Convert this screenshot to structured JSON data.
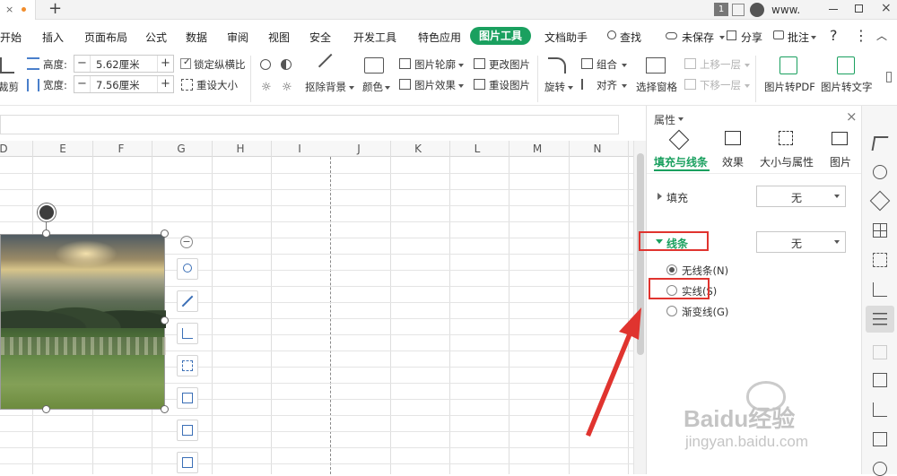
{
  "titlebar": {
    "tab_dot_color": "#f18d2c",
    "new_tab_symbol": "+",
    "page_badge": "1",
    "user_name": "www."
  },
  "menu": {
    "items": [
      "开始",
      "插入",
      "页面布局",
      "公式",
      "数据",
      "审阅",
      "视图",
      "安全",
      "开发工具",
      "特色应用",
      "图片工具",
      "文档助手"
    ],
    "active_tab": "图片工具",
    "active_color": "#1aa05f",
    "search_label": "查找",
    "unsaved_label": "未保存",
    "share_label": "分享",
    "comment_label": "批注",
    "help_symbol": "?"
  },
  "ribbon": {
    "crop_label": "裁剪",
    "height_label": "高度:",
    "height_value": "5.62厘米",
    "width_label": "宽度:",
    "width_value": "7.56厘米",
    "lock_ratio_label": "锁定纵横比",
    "lock_ratio_checked": true,
    "reset_size_label": "重设大小",
    "remove_bg_label": "抠除背景",
    "color_label": "颜色",
    "outline_label": "图片轮廓",
    "effects_label": "图片效果",
    "change_pic_label": "更改图片",
    "reset_pic_label": "重设图片",
    "rotate_label": "旋转",
    "group_label": "组合",
    "align_label": "对齐",
    "selection_pane_label": "选择窗格",
    "bring_forward_label": "上移一层",
    "send_backward_label": "下移一层",
    "to_pdf_label": "图片转PDF",
    "to_text_label": "图片转文字"
  },
  "sheet": {
    "columns": [
      "D",
      "E",
      "F",
      "G",
      "H",
      "I",
      "J",
      "K",
      "L",
      "M",
      "N"
    ],
    "minus_symbol": "−"
  },
  "panel": {
    "title": "属性",
    "tabs": [
      {
        "label": "填充与线条",
        "icon": "fill-bucket-icon"
      },
      {
        "label": "效果",
        "icon": "effects-icon"
      },
      {
        "label": "大小与属性",
        "icon": "size-icon"
      },
      {
        "label": "图片",
        "icon": "picture-icon"
      }
    ],
    "active_tab_index": 0,
    "fill_label": "填充",
    "fill_value": "无",
    "line_label": "线条",
    "line_value": "无",
    "line_options": [
      {
        "label": "无线条(N)",
        "selected": true
      },
      {
        "label": "实线(S)",
        "selected": false
      },
      {
        "label": "渐变线(G)",
        "selected": false
      }
    ]
  },
  "watermark": {
    "brand": "Baidu经验",
    "url": "jingyan.baidu.com"
  },
  "annotation_color": "#e0342f"
}
